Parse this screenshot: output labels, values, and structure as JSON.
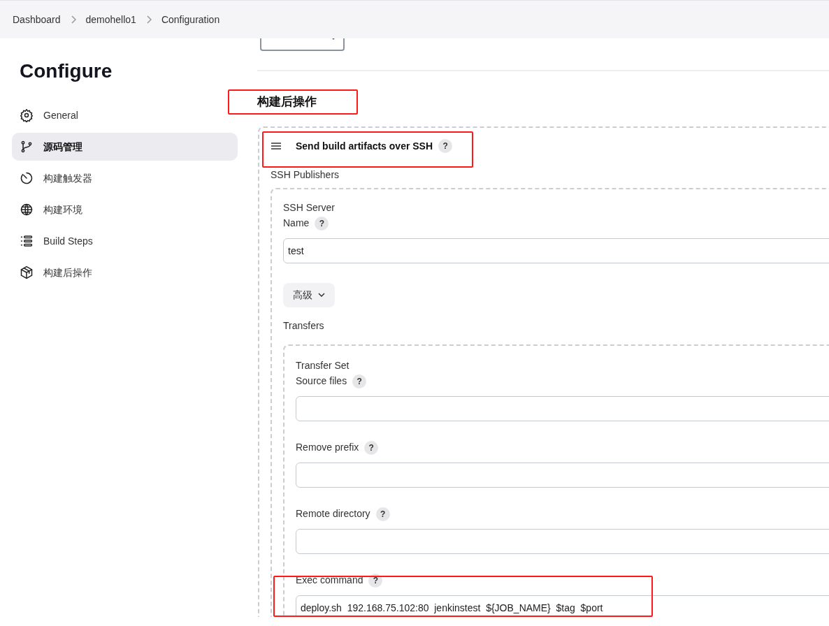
{
  "breadcrumbs": [
    "Dashboard",
    "demohello1",
    "Configuration"
  ],
  "page_title": "Configure",
  "sidebar": {
    "items": [
      {
        "label": "General",
        "selected": false
      },
      {
        "label": "源码管理",
        "selected": true
      },
      {
        "label": "构建触发器",
        "selected": false
      },
      {
        "label": "构建环境",
        "selected": false
      },
      {
        "label": "Build Steps",
        "selected": false
      },
      {
        "label": "构建后操作",
        "selected": false
      }
    ]
  },
  "section_heading": "构建后操作",
  "publisher": {
    "title": "Send build artifacts over SSH",
    "help": "?",
    "label": "SSH Publishers",
    "server": {
      "heading": "SSH Server",
      "name_label": "Name",
      "name_help": "?",
      "name_value": "test",
      "advanced_button": "高级",
      "transfers_label": "Transfers",
      "transfer_set": {
        "heading": "Transfer Set",
        "fields": [
          {
            "label": "Source files",
            "help": "?"
          },
          {
            "label": "Remove prefix",
            "help": "?"
          },
          {
            "label": "Remote directory",
            "help": "?"
          },
          {
            "label": "Exec command",
            "help": "?",
            "value": "deploy.sh  192.168.75.102:80  jenkinstest  ${JOB_NAME}  $tag  $port"
          }
        ]
      }
    }
  }
}
